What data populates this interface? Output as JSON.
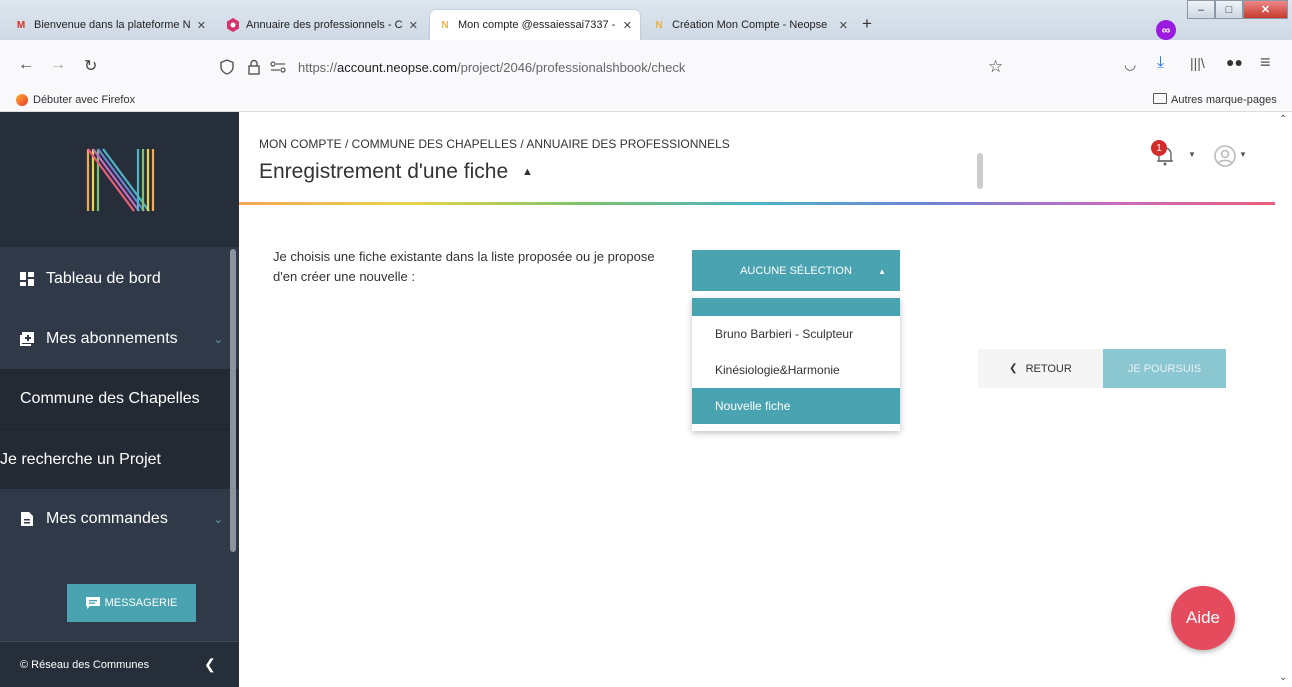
{
  "browser": {
    "tabs": [
      {
        "label": "Bienvenue dans la plateforme N",
        "icon": "gmail-icon",
        "color": "#d93025"
      },
      {
        "label": "Annuaire des professionnels - C",
        "icon": "site-icon",
        "color": "#d6336c"
      },
      {
        "label": "Mon compte @essaiessai7337 - ",
        "icon": "neopse-icon",
        "color": "#e9b34a"
      },
      {
        "label": "Création Mon Compte - Neopse",
        "icon": "neopse-icon",
        "color": "#e9b34a"
      }
    ],
    "new_tab": "+",
    "url_host": "account.neopse.com",
    "url_prefix": "https://",
    "url_path": "/project/2046/professionalshbook/check",
    "bookmark_left": "Débuter avec Firefox",
    "bookmark_right": "Autres marque-pages"
  },
  "sidebar": {
    "items": [
      {
        "label": "Tableau de bord",
        "icon": "dashboard-icon"
      },
      {
        "label": "Mes abonnements",
        "icon": "subscriptions-icon"
      },
      {
        "label": "Commune des Chapelles"
      },
      {
        "label": "Je recherche un Projet"
      },
      {
        "label": "Mes commandes",
        "icon": "orders-icon"
      }
    ],
    "messagerie": "MESSAGERIE",
    "footer": "© Réseau des Communes"
  },
  "header": {
    "breadcrumb": "MON COMPTE / COMMUNE DES CHAPELLES / ANNUAIRE DES PROFESSIONNELS",
    "title": "Enregistrement d'une fiche",
    "notification_count": "1"
  },
  "main": {
    "intro": "Je choisis une fiche existante dans la liste proposée ou je propose d'en créer une nouvelle :",
    "select_label": "AUCUNE SÉLECTION",
    "options": [
      "Bruno Barbieri - Sculpteur",
      "Kinésiologie&Harmonie",
      "Nouvelle fiche"
    ],
    "back_label": "RETOUR",
    "continue_label": "JE POURSUIS",
    "help_label": "Aide"
  },
  "colors": {
    "accent": "#4aa3b1",
    "sidebar": "#2f3947",
    "help": "#e44b5c"
  }
}
